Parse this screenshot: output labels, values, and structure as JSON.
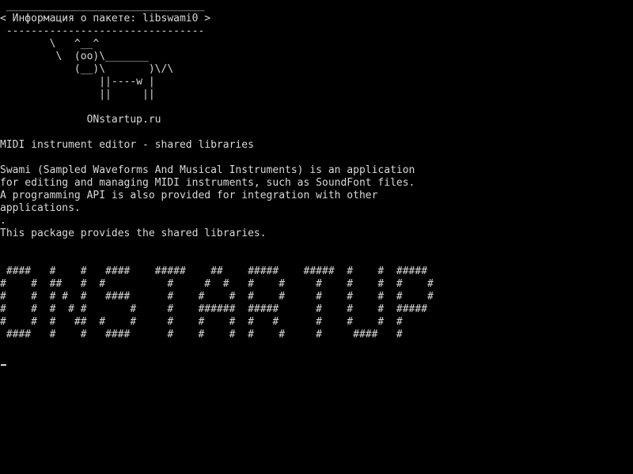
{
  "terminal": {
    "fg_color": "#d8d8d8",
    "bg_color": "#000000",
    "cowsay": {
      "border_top": " ________________________________",
      "message": "< Информация о пакете: libswami0 >",
      "border_bottom": " --------------------------------",
      "cow": [
        "        \\   ^__^",
        "         \\  (oo)\\_______",
        "            (__)\\       )\\/\\",
        "                ||----w |",
        "                ||     ||"
      ]
    },
    "site_line": "              ONstartup.ru",
    "description": {
      "title": "MIDI instrument editor - shared libraries",
      "body": [
        "Swami (Sampled Waveforms And Musical Instruments) is an application",
        "for editing and managing MIDI instruments, such as SoundFont files.",
        "A programming API is also provided for integration with other",
        "applications.",
        ".",
        "This package provides the shared libraries."
      ]
    },
    "banner": [
      " ####   #    #   ####    #####    ##    #####    #####  #    #  #####",
      "#    #  ##   #  #          #     #  #   #    #     #    #    #  #    #",
      "#    #  # #  #   ####      #    #    #  #    #     #    #    #  #    #",
      "#    #  #  # #       #     #    ######  #####      #    #    #  #####",
      "#    #  #   ##  #    #     #    #    #  #   #      #    #    #  #",
      " ####   #    #   ####      #    #    #  #    #     #     ####   #"
    ]
  }
}
